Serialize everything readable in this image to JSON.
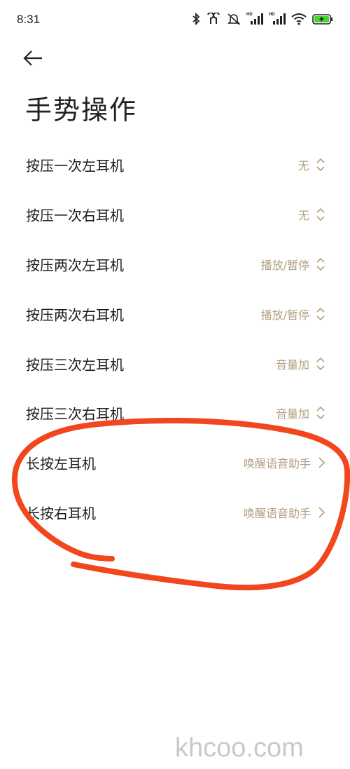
{
  "status_bar": {
    "time": "8:31",
    "icons": [
      "bluetooth-icon",
      "earbuds-icon",
      "mute-icon",
      "hd-signal-icon",
      "hd-signal-icon",
      "wifi-icon",
      "battery-charging-icon"
    ],
    "hd_label": "HD",
    "battery_color": "#4cd137"
  },
  "header": {
    "back_icon": "arrow-left-icon",
    "title": "手势操作"
  },
  "settings": [
    {
      "label": "按压一次左耳机",
      "value": "无",
      "control": "updown"
    },
    {
      "label": "按压一次右耳机",
      "value": "无",
      "control": "updown"
    },
    {
      "label": "按压两次左耳机",
      "value": "播放/暂停",
      "control": "updown"
    },
    {
      "label": "按压两次右耳机",
      "value": "播放/暂停",
      "control": "updown"
    },
    {
      "label": "按压三次左耳机",
      "value": "音量加",
      "control": "updown"
    },
    {
      "label": "按压三次右耳机",
      "value": "音量加",
      "control": "updown"
    },
    {
      "label": "长按左耳机",
      "value": "唤醒语音助手",
      "control": "chevron"
    },
    {
      "label": "长按右耳机",
      "value": "唤醒语音助手",
      "control": "chevron"
    }
  ],
  "colors": {
    "value_text": "#b19f80",
    "annotation_stroke": "#f2461c"
  },
  "watermark": "khcoo.com"
}
